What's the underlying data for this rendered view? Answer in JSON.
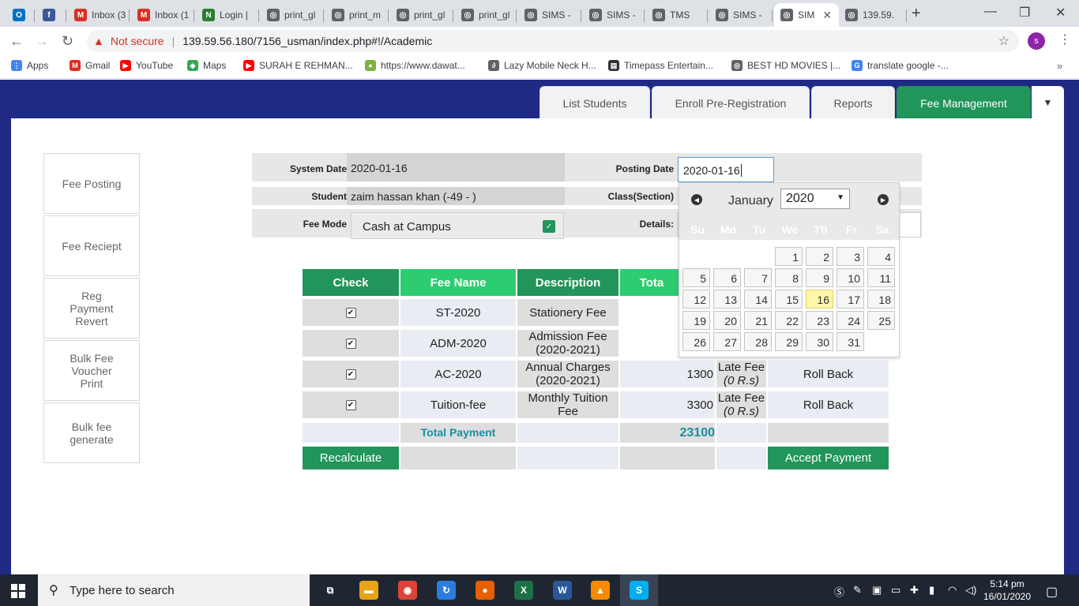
{
  "browser": {
    "tabs": [
      {
        "label": "",
        "icon": "outlook-icon",
        "color": "#0072c6"
      },
      {
        "label": "",
        "icon": "facebook-icon",
        "color": "#3b5998"
      },
      {
        "label": "Inbox (3",
        "icon": "gmail-icon",
        "color": "#d93025"
      },
      {
        "label": "Inbox (1",
        "icon": "gmail-icon",
        "color": "#d93025"
      },
      {
        "label": "Login |",
        "icon": "in-icon",
        "color": "#2e7d32"
      },
      {
        "label": "print_gl",
        "icon": "globe-icon",
        "color": "#5f6368"
      },
      {
        "label": "print_m",
        "icon": "globe-icon",
        "color": "#5f6368"
      },
      {
        "label": "print_gl",
        "icon": "globe-icon",
        "color": "#5f6368"
      },
      {
        "label": "print_gl",
        "icon": "globe-icon",
        "color": "#5f6368"
      },
      {
        "label": "SIMS -",
        "icon": "globe-icon",
        "color": "#5f6368"
      },
      {
        "label": "SIMS -",
        "icon": "globe-icon",
        "color": "#5f6368"
      },
      {
        "label": "TMS",
        "icon": "globe-icon",
        "color": "#5f6368"
      },
      {
        "label": "SIMS -",
        "icon": "globe-icon",
        "color": "#5f6368"
      },
      {
        "label": "SIM",
        "icon": "globe-icon",
        "color": "#5f6368"
      },
      {
        "label": "139.59.",
        "icon": "globe-icon",
        "color": "#5f6368"
      }
    ],
    "new_tab": "+",
    "active_tab_close": "✕",
    "window_controls": {
      "minimize": "—",
      "restore": "❐",
      "close": "✕"
    },
    "address": {
      "security_label": "Not secure",
      "url": "139.59.56.180/7156_usman/index.php#!/Academic"
    },
    "profile_initial": "s",
    "bookmarks": [
      {
        "label": "Apps",
        "icon": "apps-icon",
        "color": "#4285f4"
      },
      {
        "label": "Gmail",
        "icon": "gmail-icon",
        "color": "#d93025"
      },
      {
        "label": "YouTube",
        "icon": "youtube-icon",
        "color": "#ff0000"
      },
      {
        "label": "Maps",
        "icon": "maps-icon",
        "color": "#34a853"
      },
      {
        "label": "SURAH E REHMAN...",
        "icon": "youtube-icon",
        "color": "#ff0000"
      },
      {
        "label": "https://www.dawat...",
        "icon": "dawat-icon",
        "color": "#7cb342"
      },
      {
        "label": "Lazy Mobile Neck H...",
        "icon": "link-icon",
        "color": "#5f6368"
      },
      {
        "label": "Timepass Entertain...",
        "icon": "film-icon",
        "color": "#333333"
      },
      {
        "label": "BEST HD MOVIES |...",
        "icon": "globe-icon",
        "color": "#5f6368"
      },
      {
        "label": "translate google -...",
        "icon": "google-icon",
        "color": "#4285f4"
      }
    ],
    "bookmarks_more": "»"
  },
  "nav": {
    "tabs": [
      "List Students",
      "Enroll Pre-Registration",
      "Reports",
      "Fee Management"
    ],
    "active_index": 3,
    "dropdown_icon": "▼"
  },
  "sidebar": [
    "Fee Posting",
    "Fee Reciept",
    "Reg Payment Revert",
    "Bulk Fee Voucher Print",
    "Bulk fee generate"
  ],
  "form": {
    "system_date_label": "System Date",
    "system_date": "2020-01-16",
    "posting_date_label": "Posting Date",
    "posting_date": "2020-01-16",
    "student_label": "Student",
    "student": "zaim hassan khan (-49 - )",
    "class_label": "Class(Section)",
    "fee_mode_label": "Fee Mode",
    "fee_mode": "Cash at Campus",
    "details_label": "Details:"
  },
  "table": {
    "headers": [
      "Check",
      "Fee Name",
      "Description",
      "Tota"
    ],
    "rows": [
      {
        "name": "ST-2020",
        "description": "Stationery Fee",
        "amount": "",
        "late": "",
        "action": ""
      },
      {
        "name": "ADM-2020",
        "description": "Admission Fee (2020-2021)",
        "amount": "",
        "late": "",
        "action": ""
      },
      {
        "name": "AC-2020",
        "description": "Annual Charges (2020-2021)",
        "amount": "1300",
        "late_label": "Late Fee",
        "late_value": "(0 R.s)",
        "action": "Roll Back"
      },
      {
        "name": "Tuition-fee",
        "description": "Monthly Tuition Fee",
        "amount": "3300",
        "late_label": "Late Fee",
        "late_value": "(0 R.s)",
        "action": "Roll Back"
      }
    ],
    "checked": [
      true,
      true,
      true,
      true
    ],
    "total_label": "Total Payment",
    "total_value": "23100",
    "recalculate": "Recalculate",
    "accept": "Accept Payment"
  },
  "datepicker": {
    "month": "January",
    "year": "2020",
    "weekdays": [
      "Su",
      "Mo",
      "Tu",
      "We",
      "Th",
      "Fr",
      "Sa"
    ],
    "first_weekday_index": 3,
    "days_in_month": 31,
    "selected_day": 16
  },
  "taskbar": {
    "search_placeholder": "Type here to search",
    "time": "5:14 pm",
    "date": "16/01/2020",
    "apps": [
      {
        "icon": "task-view-icon",
        "color": "#1f2631",
        "glyph": "⧉"
      },
      {
        "icon": "file-explorer-icon",
        "color": "#e8a317",
        "glyph": "▬"
      },
      {
        "icon": "chrome-icon",
        "color": "#db4437",
        "glyph": "◉"
      },
      {
        "icon": "dolphin-icon",
        "color": "#2a7de1",
        "glyph": "↻"
      },
      {
        "icon": "firefox-icon",
        "color": "#e66000",
        "glyph": "●"
      },
      {
        "icon": "excel-icon",
        "color": "#1e7145",
        "glyph": "X"
      },
      {
        "icon": "word-icon",
        "color": "#2b579a",
        "glyph": "W"
      },
      {
        "icon": "vlc-icon",
        "color": "#f48b00",
        "glyph": "▲"
      },
      {
        "icon": "skype-icon",
        "color": "#00aff0",
        "glyph": "S"
      }
    ]
  },
  "colors": {
    "brand_dark": "#1f2a85",
    "accent_green": "#21955a",
    "header_light_green": "#2ecc71",
    "total_teal": "#1a8fa3"
  }
}
